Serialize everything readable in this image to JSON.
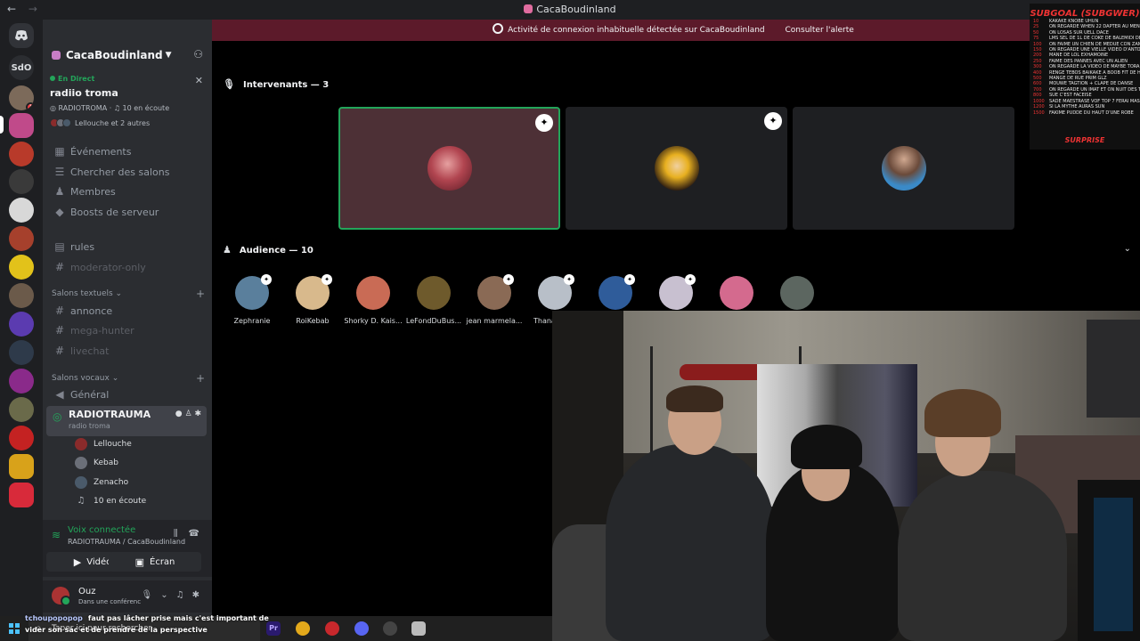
{
  "window": {
    "title": "CacaBoudinland",
    "back": "←",
    "forward": "→"
  },
  "alert": {
    "text": "Activité de connexion inhabituelle détectée sur CacaBoudinland",
    "action": "Consulter l'alerte"
  },
  "rail": {
    "sdo_label": "SdO",
    "badge": "1"
  },
  "server": {
    "name": "CacaBoudinland"
  },
  "live": {
    "status": "En Direct",
    "stage_name": "radiio troma",
    "channel": "RADIOTROMA",
    "listening": "10 en écoute",
    "participants": "Lellouche et 2 autres"
  },
  "nav": [
    {
      "label": "Événements",
      "icon": "calendar"
    },
    {
      "label": "Chercher des salons",
      "icon": "search-channels"
    },
    {
      "label": "Membres",
      "icon": "members"
    },
    {
      "label": "Boosts de serveur",
      "icon": "boost"
    }
  ],
  "channels_top": [
    {
      "label": "rules",
      "icon": "rules"
    },
    {
      "label": "moderator-only",
      "icon": "hash"
    }
  ],
  "text_category": "Salons textuels",
  "text_channels": [
    "annonce",
    "mega-hunter",
    "livechat"
  ],
  "voice_category": "Salons vocaux",
  "voice_general": "Général",
  "active_voice": {
    "name": "RADIOTRAUMA",
    "sub": "radio troma"
  },
  "voice_members": [
    {
      "name": "Lellouche",
      "color": "#8a2b2b"
    },
    {
      "name": "Kebab",
      "color": "#6b6f78"
    },
    {
      "name": "Zenacho",
      "color": "#4a5a6a"
    }
  ],
  "voice_listening": "10 en écoute",
  "voice_panel": {
    "status": "Voix connectée",
    "location": "RADIOTRAUMA / CacaBoudinland",
    "video": "Vidéo",
    "screen": "Écran"
  },
  "user": {
    "name": "Ouz",
    "status": "Dans une conférenc"
  },
  "speakers": {
    "label": "Intervenants — 3"
  },
  "audience": {
    "label": "Audience — 10",
    "members": [
      {
        "name": "Zephranie",
        "color": "#5a7f9c"
      },
      {
        "name": "RoiKebab",
        "color": "#d8b98c"
      },
      {
        "name": "Shorky D. Kais...",
        "color": "#c96b55"
      },
      {
        "name": "LeFondDuBus...",
        "color": "#6e5a2c"
      },
      {
        "name": "jean marmela...",
        "color": "#8a6a55"
      },
      {
        "name": "Thana",
        "color": "#b8bfc8"
      },
      {
        "name": "",
        "color": "#2f5c9a"
      },
      {
        "name": "",
        "color": "#c8c0d0"
      },
      {
        "name": "",
        "color": "#d46a8e"
      },
      {
        "name": "",
        "color": "#5c6660"
      }
    ]
  },
  "speaker_tiles": [
    {
      "color": "#b14550",
      "moderator": true,
      "selected": true
    },
    {
      "color": "#e8b020",
      "moderator": true,
      "selected": false
    },
    {
      "color": "#3a8ac8",
      "moderator": false,
      "selected": false
    }
  ],
  "overlay": {
    "title": "SUBGOAL (SUBGWER)",
    "bottom": "SURPRISE",
    "goals": [
      [
        "10",
        "KAKAKE KNOBE UHUN"
      ],
      [
        "25",
        "ON REGARDE WHEN 22 DAPTER AU MENU"
      ],
      [
        "50",
        "ON LOSAS SUR UELL DACE"
      ],
      [
        "75",
        "LMS SEL DE 1L DE COKE DE BALEMIDI DE WEEW"
      ],
      [
        "100",
        "ON FAIME UN CHIEN DE MEDUE CON ZAMOO"
      ],
      [
        "150",
        "ON REGARDE UNE VIELLE VIDEO D'ANTOINE"
      ],
      [
        "200",
        "MANE DE LOL EXHAMOINE"
      ],
      [
        "250",
        "FAIME DES PANNES AVEC UN ALIEN"
      ],
      [
        "300",
        "ON REGARDE LA VIDEO DE MAYBE TORA"
      ],
      [
        "400",
        "RENGE TEBOS BAIKAKE A BOOB FIT DE HOIT"
      ],
      [
        "500",
        "MANGE DE RUE PRIM GLZ"
      ],
      [
        "600",
        "MOUWE TAGTION + CLAPE DE DANSE"
      ],
      [
        "700",
        "ON REGARDE UN IMAT ET ON NUIT DES TROP"
      ],
      [
        "800",
        "SUE C'EST FACEISE"
      ],
      [
        "1000",
        "SADE MAESTRASE VOF TOP 7 FERAI MASS 2"
      ],
      [
        "1200",
        "SI LA MYTHE AURAS SUN"
      ],
      [
        "1500",
        "FAKIME PUDDE DU HAUT D'UNE ROBE"
      ]
    ]
  },
  "chat": {
    "user": "tchoupopopop",
    "message": "faut pas lâcher prise mais c'est important de vider son sac et de prendre de la perspective"
  },
  "taskbar": {
    "search_placeholder": "Taper ici pour rechercher",
    "apps": [
      {
        "label": "Pr",
        "color": "#2a1a6e"
      },
      {
        "label": "",
        "color": "#e3a91b"
      },
      {
        "label": "",
        "color": "#c8282c"
      },
      {
        "label": "",
        "color": "#5865f2"
      },
      {
        "label": "",
        "color": "#444"
      },
      {
        "label": "",
        "color": "#bbb"
      }
    ]
  }
}
